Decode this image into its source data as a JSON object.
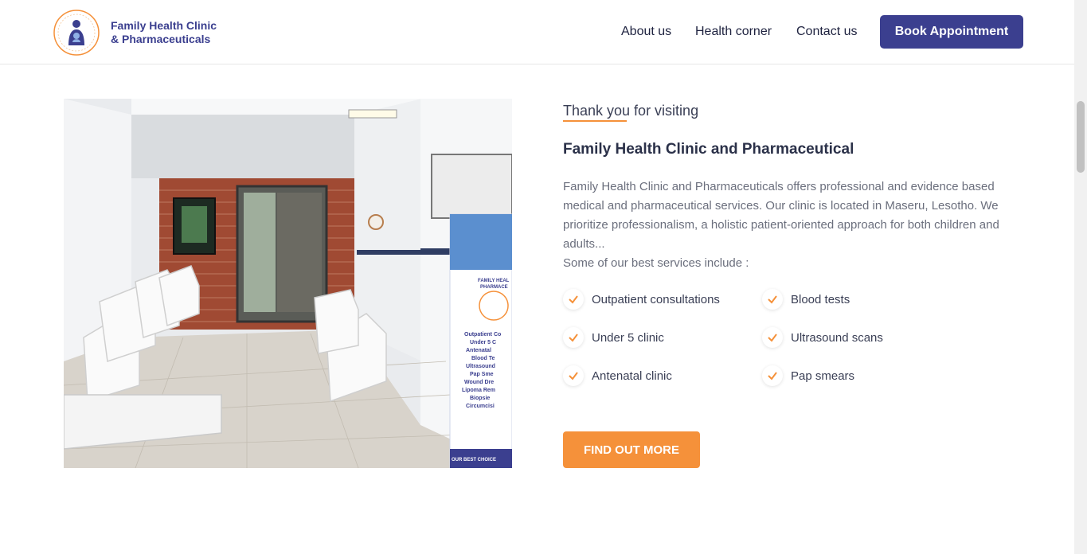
{
  "header": {
    "brand_line1": "Family Health Clinic",
    "brand_line2": "& Pharmaceuticals",
    "nav": [
      "About us",
      "Health corner",
      "Contact us"
    ],
    "cta": "Book Appointment"
  },
  "colors": {
    "brand_primary": "#3b3f8f",
    "accent_orange": "#f5913a"
  },
  "main": {
    "eyebrow": "Thank you for visiting",
    "title": "Family Health Clinic and Pharmaceutical",
    "paragraph1": "Family Health Clinic and Pharmaceuticals offers professional and evidence based medical and pharmaceutical services. Our clinic is located in Maseru, Lesotho. We prioritize professionalism, a holistic patient-oriented approach for both children and adults...",
    "paragraph2": "Some of our best services include :",
    "services": [
      "Outpatient consultations",
      "Blood tests",
      "Under 5 clinic",
      "Ultrasound scans",
      "Antenatal clinic",
      "Pap smears"
    ],
    "button": "FIND OUT MORE"
  },
  "photo": {
    "banner_lines": [
      "FAMILY HEAL",
      "PHARMACE",
      "Outpatient Co",
      "Under 5 C",
      "Antenatal",
      "Blood Te",
      "Ultrasound",
      "Pap Sme",
      "Wound Dre",
      "Lipoma Rem",
      "Biopsie",
      "Circumcisi",
      "OUR BEST CHOICE"
    ]
  }
}
